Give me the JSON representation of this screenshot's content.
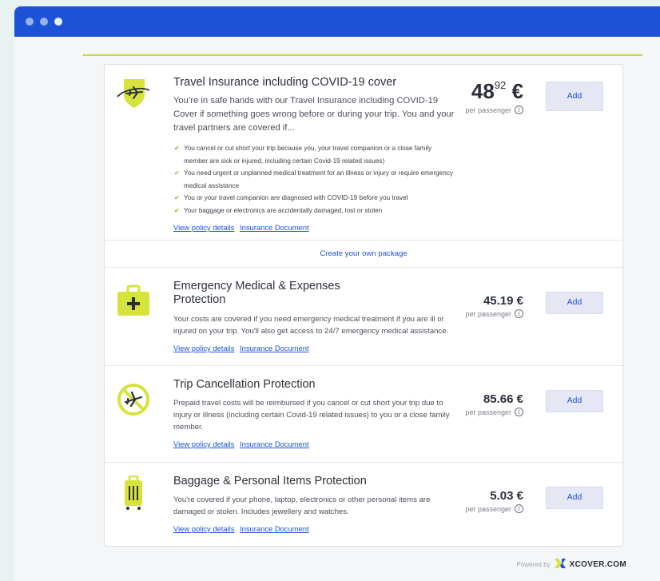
{
  "colors": {
    "titlebar": "#1b52d6",
    "accent_green": "#c6d93a",
    "icon_yellow": "#d6e33a",
    "link": "#1b52d6"
  },
  "main_offer": {
    "title": "Travel Insurance including COVID-19 cover",
    "description": "You’re in safe hands with our Travel Insurance including COVID-19 Cover if something goes wrong before or during your trip. You and your travel partners are covered if...",
    "bullets": [
      "You cancel or cut short your trip because you, your travel companion or a close family member are sick or injured, including certain Covid-19 related issues)",
      "You need urgent or unplanned medical treatment for an illness or injury or require emergency medical assistance",
      "You or your travel companion are diagnosed with COVID-19 before you travel",
      "Your baggage or electronics are accidentally damaged, lost or stolen"
    ],
    "price_whole": "48",
    "price_decimal": "92",
    "currency": "€",
    "per_label": "per passenger",
    "add_label": "Add",
    "view_policy": "View policy details",
    "insurance_doc": "Insurance Document",
    "icon": "plane-shield-icon"
  },
  "package_label": "Create your own package",
  "products": [
    {
      "title": "Emergency Medical & Expenses Protection",
      "description": "Your costs are covered if you need emergency medical treatment if you are ill or injured on your trip. You'll also get access to 24/7 emergency medical assistance.",
      "price": "45.19 €",
      "per_label": "per passenger",
      "add_label": "Add",
      "view_policy": "View policy details",
      "insurance_doc": "Insurance Document",
      "icon": "medical-kit-icon"
    },
    {
      "title": "Trip Cancellation Protection",
      "description": "Prepaid travel costs will be reimbursed if you cancel or cut short your trip due to injury or illness (including certain Covid-19 related issues) to you or a close family member.",
      "price": "85.66 €",
      "per_label": "per passenger",
      "add_label": "Add",
      "view_policy": "View policy details",
      "insurance_doc": "Insurance Document",
      "icon": "cancelled-flight-icon"
    },
    {
      "title": "Baggage & Personal Items Protection",
      "description": "You're covered if your phone, laptop, electronics or other personal items are damaged or stolen. Includes jewellery and watches.",
      "price": "5.03 €",
      "per_label": "per passenger",
      "add_label": "Add",
      "view_policy": "View policy details",
      "insurance_doc": "Insurance Document",
      "icon": "luggage-icon"
    }
  ],
  "footer": {
    "powered_by": "Powered by",
    "brand": "XCOVER.COM"
  }
}
